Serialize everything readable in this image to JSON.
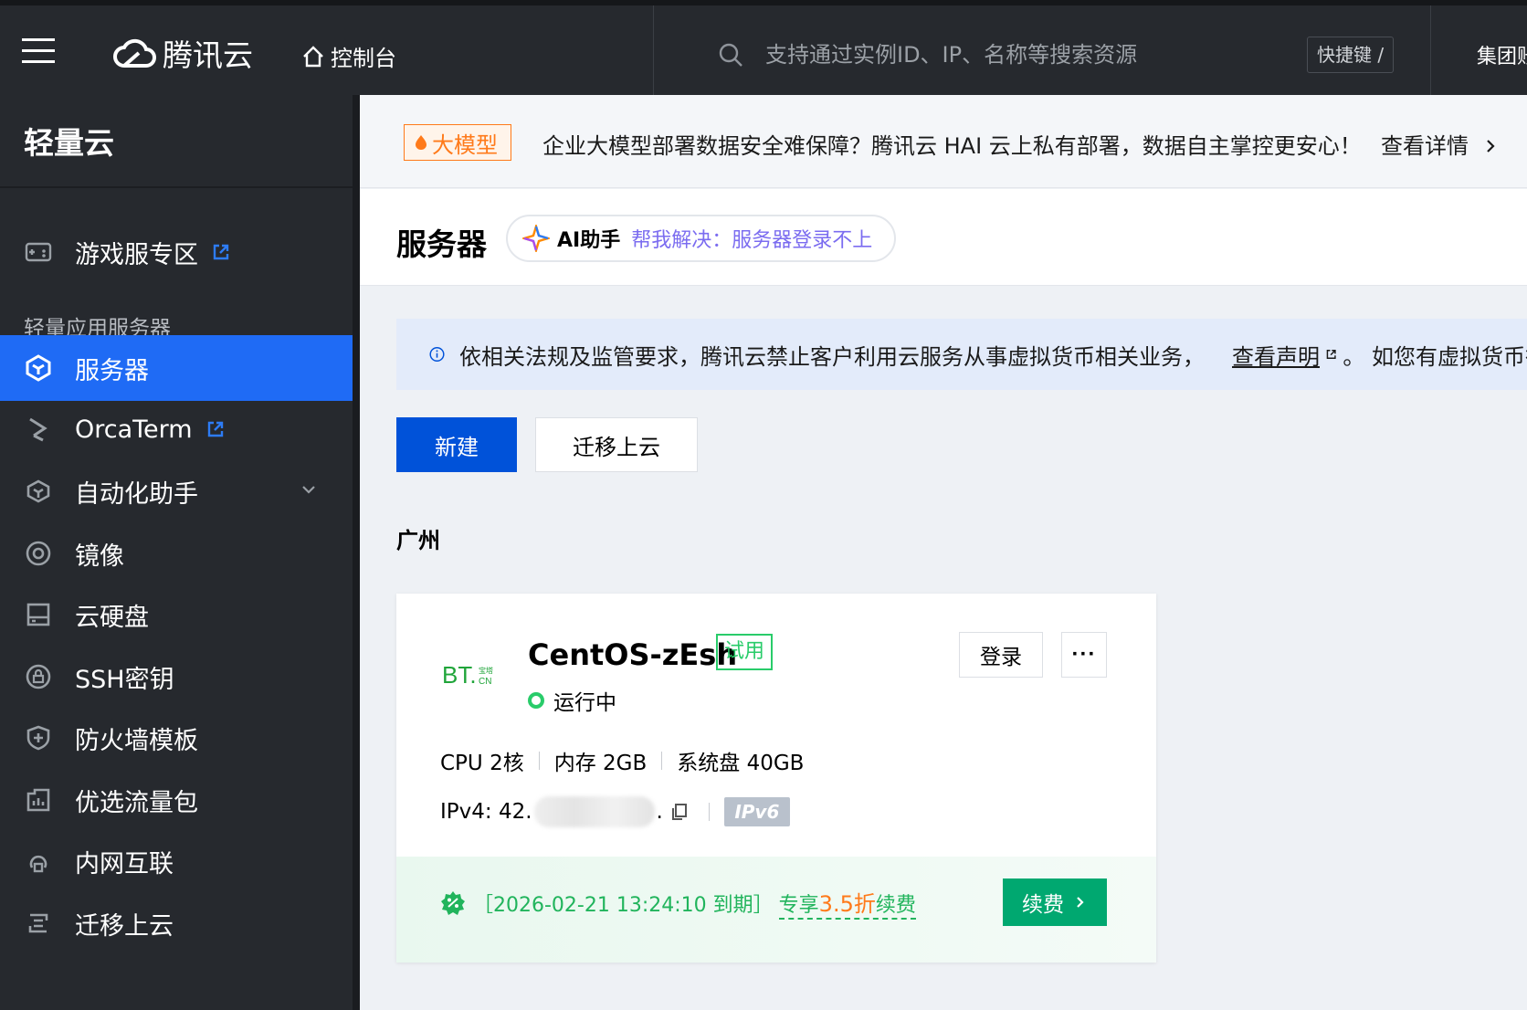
{
  "topbar": {
    "brand": "腾讯云",
    "console": "控制台",
    "search_placeholder": "支持通过实例ID、IP、名称等搜索资源",
    "shortcut": "快捷键 /",
    "group": "集团账"
  },
  "sidebar": {
    "title": "轻量云",
    "section_label": "轻量应用服务器",
    "items": [
      {
        "label": "游戏服专区",
        "icon": "gamepad-icon"
      },
      {
        "label": "服务器",
        "icon": "cube-icon"
      },
      {
        "label": "OrcaTerm",
        "icon": "terminal-icon"
      },
      {
        "label": "自动化助手",
        "icon": "robot-icon"
      },
      {
        "label": "镜像",
        "icon": "disc-icon"
      },
      {
        "label": "云硬盘",
        "icon": "disk-icon"
      },
      {
        "label": "SSH密钥",
        "icon": "key-icon"
      },
      {
        "label": "防火墙模板",
        "icon": "shield-icon"
      },
      {
        "label": "优选流量包",
        "icon": "traffic-icon"
      },
      {
        "label": "内网互联",
        "icon": "network-icon"
      },
      {
        "label": "迁移上云",
        "icon": "migrate-icon"
      }
    ]
  },
  "announcement": {
    "tag": "大模型",
    "text": "企业大模型部署数据安全难保障？腾讯云 HAI 云上私有部署，数据自主掌控更安心！",
    "link": "查看详情"
  },
  "page": {
    "title": "服务器",
    "ai_label": "AI助手",
    "ai_hint": "帮我解决：服务器登录不上"
  },
  "notice": {
    "text": "依相关法规及监管要求，腾讯云禁止客户利用云服务从事虚拟货币相关业务，",
    "link": "查看声明",
    "after": "。 如您有虚拟货币行"
  },
  "actions": {
    "new": "新建",
    "migrate": "迁移上云"
  },
  "region": "广州",
  "server": {
    "name": "CentOS-zEsh",
    "tag": "试用",
    "status": "运行中",
    "login": "登录",
    "more": "···",
    "cpu": "CPU 2核",
    "memory": "内存 2GB",
    "disk": "系统盘 40GB",
    "ipv4_prefix": "IPv4: 42.",
    "ipv4_suffix": ".",
    "ipv6": "IPv6",
    "expire": "［2026-02-21 13:24:10 到期］",
    "promo_prefix": "专享",
    "promo_discount": "3.5折",
    "promo_suffix": "续费",
    "renew": "续费"
  },
  "colors": {
    "topbar_bg": "#26292e",
    "active_blue": "#1f6bf5",
    "primary_button": "#0052d9",
    "running_green": "#29cc6a",
    "renew_green": "#00a870",
    "discount_orange": "#ff7a1a"
  }
}
